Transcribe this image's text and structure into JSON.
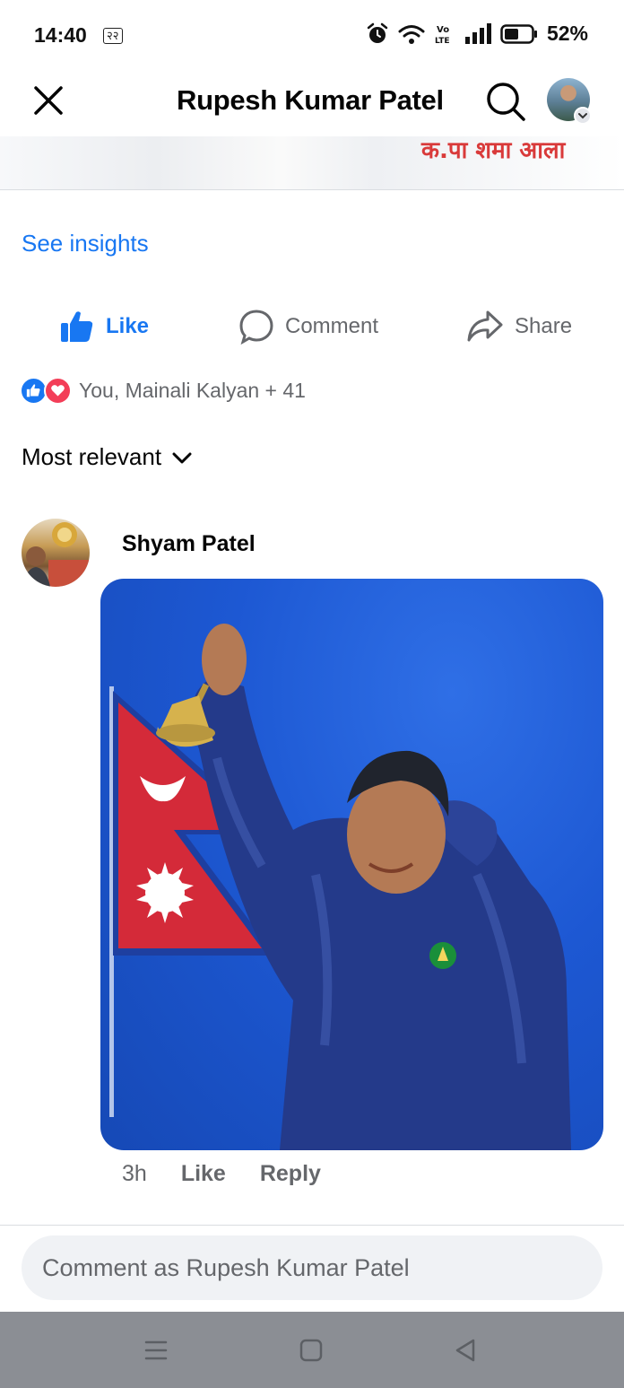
{
  "status_bar": {
    "time": "14:40",
    "device_badge": "२२",
    "battery": "52%",
    "icons": [
      "alarm-icon",
      "wifi-icon",
      "volte-icon",
      "signal-icon",
      "battery-icon"
    ]
  },
  "header": {
    "title": "Rupesh Kumar Patel",
    "close_icon": "close-icon",
    "search_icon": "search-icon"
  },
  "post": {
    "remnant_text": "क.पा शमा आला",
    "insights_link": "See insights"
  },
  "actions": {
    "like": "Like",
    "comment": "Comment",
    "share": "Share"
  },
  "reactions": {
    "summary": "You, Mainali Kalyan + 41",
    "types": [
      "like",
      "love"
    ]
  },
  "sort": {
    "label": "Most relevant"
  },
  "comments": [
    {
      "author": "Shyam Patel",
      "attachment": "photo",
      "time": "3h",
      "like_label": "Like",
      "reply_label": "Reply"
    }
  ],
  "composer": {
    "placeholder": "Comment as Rupesh Kumar Patel"
  },
  "colors": {
    "accent": "#1877f2",
    "secondary_text": "#65676b",
    "love": "#f33e58",
    "nav_bar": "#8b8e94"
  }
}
